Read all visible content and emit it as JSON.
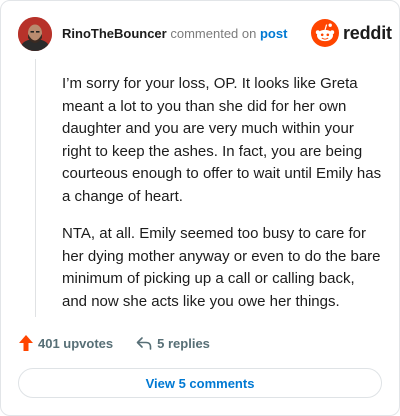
{
  "comment": {
    "author": "RinoTheBouncer",
    "action_text": "commented on",
    "post_link": "post",
    "paragraphs": [
      "I’m sorry for your loss, OP. It looks like Greta meant a lot to you than she did for her own daughter and you are very much within your right to keep the ashes. In fact, you are being courteous enough to offer to wait until Emily has a change of heart.",
      "NTA, at all. Emily seemed too busy to care for her dying mother anyway or even to do the bare minimum of picking up a call or calling back, and now she acts like you owe her things."
    ],
    "upvotes_label": "401 upvotes",
    "replies_label": "5 replies",
    "view_comments_label": "View 5 comments"
  },
  "logo": {
    "text": "reddit",
    "icon": "reddit-alien-icon"
  },
  "colors": {
    "reddit_orange": "#ff4500",
    "link_blue": "#0079d3",
    "upvote_orange": "#ff4500",
    "meta_gray": "#576f76"
  }
}
